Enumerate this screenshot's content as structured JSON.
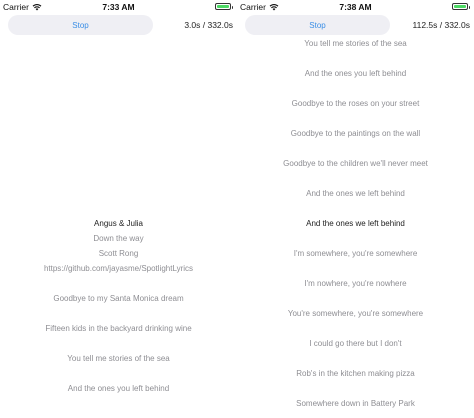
{
  "left_screen": {
    "status_bar": {
      "carrier": "Carrier",
      "wifi_icon": "wifi-icon",
      "time": "7:33 AM",
      "battery_icon": "battery-full-icon"
    },
    "controls": {
      "stop_label": "Stop",
      "progress": "3.0s / 332.0s"
    },
    "lines": [
      "Angus & Julia",
      "Down the way",
      "Scott Rong",
      "https://github.com/jayasme/SpotlightLyrics",
      "Goodbye to my Santa Monica dream",
      "Fifteen kids in the backyard drinking wine",
      "You tell me stories of the sea",
      "And the ones you left behind"
    ]
  },
  "right_screen": {
    "status_bar": {
      "carrier": "Carrier",
      "wifi_icon": "wifi-icon",
      "time": "7:38 AM",
      "battery_icon": "battery-full-icon"
    },
    "controls": {
      "stop_label": "Stop",
      "progress": "112.5s / 332.0s"
    },
    "lines": [
      "You tell me stories of the sea",
      "And the ones you left behind",
      "Goodbye to the roses on your street",
      "Goodbye to the paintings on the wall",
      "Goodbye to the children we'll never meet",
      "And the ones we left behind",
      "And the ones we left behind",
      "I'm somewhere, you're somewhere",
      "I'm nowhere, you're nowhere",
      "You're somewhere, you're somewhere",
      "I could go there but I don't",
      "Rob's in the kitchen making pizza",
      "Somewhere down in Battery Park"
    ],
    "current_line_index": 6
  },
  "colors": {
    "accent": "#3a8ee6",
    "battery": "#4cd964",
    "button_background": "#efeff4",
    "inactive_lyric": "#8e8e93",
    "active_lyric": "#222222"
  }
}
